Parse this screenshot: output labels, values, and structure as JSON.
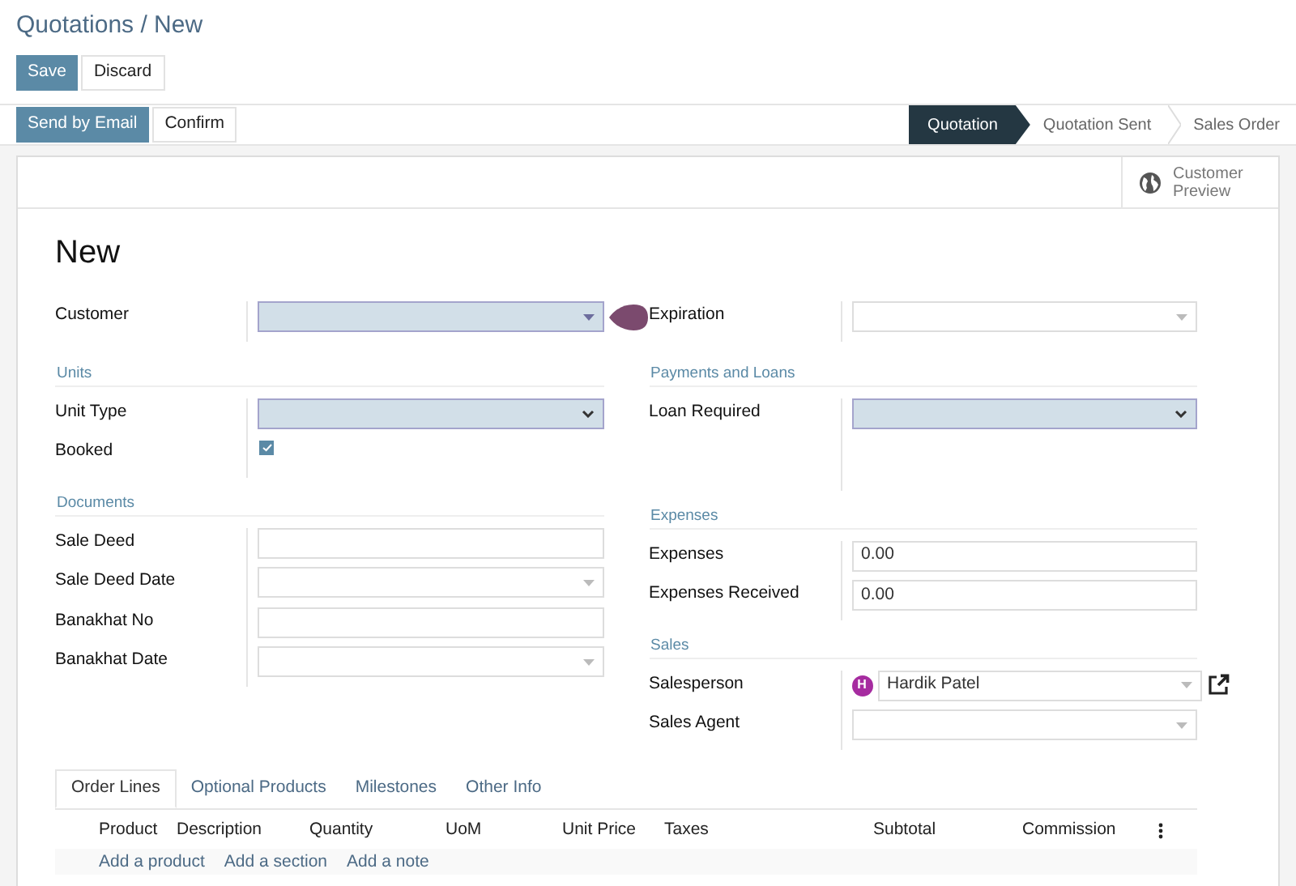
{
  "breadcrumb": "Quotations / New",
  "buttons": [
    {
      "label": "Save",
      "primary": true
    },
    {
      "label": "Discard",
      "primary": false
    }
  ],
  "status_buttons": [
    {
      "label": "Send by Email",
      "primary": true
    },
    {
      "label": "Confirm",
      "primary": false
    }
  ],
  "stages": [
    {
      "label": "Quotation",
      "selected": true
    },
    {
      "label": "Quotation Sent",
      "selected": false
    },
    {
      "label": "Sales Order",
      "selected": false
    }
  ],
  "button_box": {
    "label": "Customer Preview"
  },
  "title": "New",
  "columns": [
    [
      {
        "fields": [
          {
            "label": "Customer",
            "kind": "many2one",
            "required": true
          }
        ]
      },
      {
        "title": "Units",
        "fields": [
          {
            "label": "Unit Type",
            "kind": "selection",
            "required": true
          },
          {
            "label": "Booked",
            "kind": "checkbox",
            "checked": true
          }
        ]
      },
      {
        "title": "Documents",
        "fields": [
          {
            "label": "Sale Deed",
            "kind": "char",
            "required": false
          },
          {
            "label": "Sale Deed Date",
            "kind": "date",
            "required": false
          },
          {
            "label": "Banakhat No",
            "kind": "char",
            "required": false
          },
          {
            "label": "Banakhat Date",
            "kind": "date",
            "required": false
          }
        ]
      }
    ],
    [
      {
        "fields": [
          {
            "label": "Expiration",
            "kind": "date",
            "required": false
          }
        ]
      },
      {
        "title": "Payments and Loans",
        "fields": [
          {
            "label": "Loan Required",
            "kind": "selection",
            "required": true
          }
        ]
      },
      {
        "title": "Expenses",
        "fields": [
          {
            "label": "Expenses",
            "kind": "char",
            "required": false,
            "value": "0.00"
          },
          {
            "label": "Expenses Received",
            "kind": "char",
            "required": false,
            "value": "0.00"
          }
        ]
      },
      {
        "title": "Sales",
        "fields": [
          {
            "label": "Salesperson",
            "kind": "many2one",
            "required": false,
            "value": "Hardik Patel",
            "avatar": "H",
            "external_link": true
          },
          {
            "label": "Sales Agent",
            "kind": "many2one",
            "required": false
          }
        ]
      }
    ]
  ],
  "tabs": [
    {
      "label": "Order Lines",
      "selected": true
    },
    {
      "label": "Optional Products",
      "selected": false
    },
    {
      "label": "Milestones",
      "selected": false
    },
    {
      "label": "Other Info",
      "selected": false
    }
  ],
  "table": {
    "columns": [
      "Product",
      "Description",
      "Quantity",
      "UoM",
      "Unit Price",
      "Taxes",
      "Subtotal",
      "Commission"
    ],
    "add_links": [
      "Add a product",
      "Add a section",
      "Add a note"
    ]
  }
}
